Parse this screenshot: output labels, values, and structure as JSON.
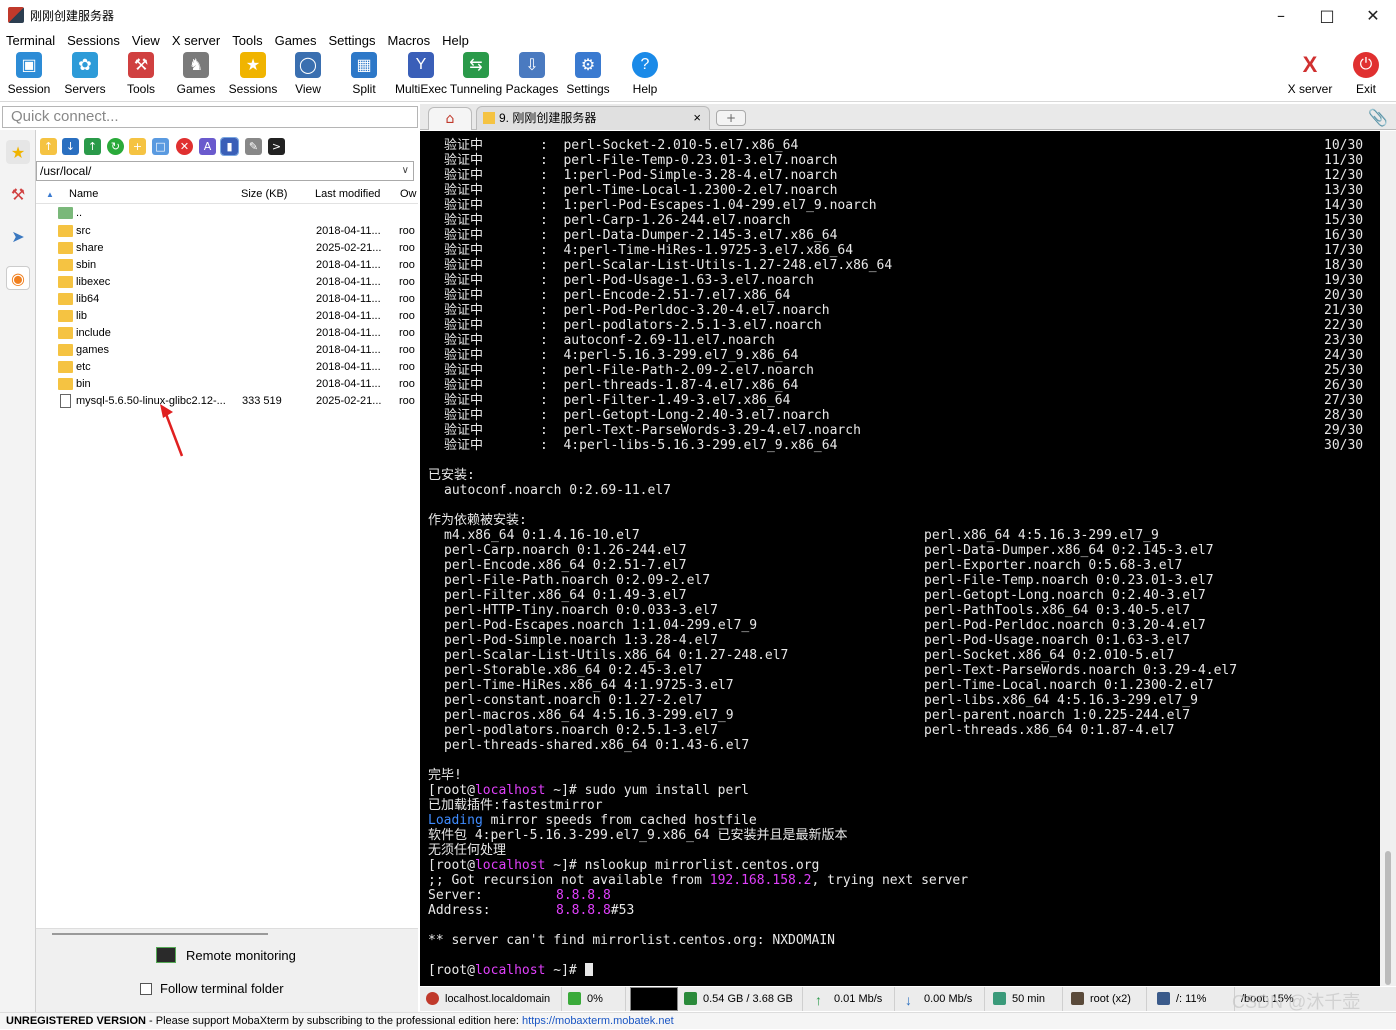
{
  "window": {
    "title": "刚刚创建服务器"
  },
  "menu": [
    "Terminal",
    "Sessions",
    "View",
    "X server",
    "Tools",
    "Games",
    "Settings",
    "Macros",
    "Help"
  ],
  "toolbar": {
    "left": [
      {
        "label": "Session",
        "icon": "monitor-icon",
        "color": "#2d8cd6"
      },
      {
        "label": "Servers",
        "icon": "servers-icon",
        "color": "#2d9bd8"
      },
      {
        "label": "Tools",
        "icon": "tools-icon",
        "color": "#d04040"
      },
      {
        "label": "Games",
        "icon": "games-icon",
        "color": "#7a7a7a"
      },
      {
        "label": "Sessions",
        "icon": "star-icon",
        "color": "#f0b400"
      },
      {
        "label": "View",
        "icon": "view-icon",
        "color": "#3a6fb0"
      },
      {
        "label": "Split",
        "icon": "split-icon",
        "color": "#2d78c8"
      },
      {
        "label": "MultiExec",
        "icon": "multiexec-icon",
        "color": "#3a5fb8"
      },
      {
        "label": "Tunneling",
        "icon": "tunneling-icon",
        "color": "#2a9a4a"
      },
      {
        "label": "Packages",
        "icon": "packages-icon",
        "color": "#4a7ac0"
      },
      {
        "label": "Settings",
        "icon": "gear-icon",
        "color": "#3a7ad0"
      },
      {
        "label": "Help",
        "icon": "help-icon",
        "color": "#1a8ae8"
      }
    ],
    "right": [
      {
        "label": "X server",
        "icon": "x-server-icon",
        "color": "#d03030"
      },
      {
        "label": "Exit",
        "icon": "power-icon",
        "color": "#e03030"
      }
    ]
  },
  "quick_connect": {
    "placeholder": "Quick connect..."
  },
  "file_browser": {
    "path": "/usr/local/",
    "columns": [
      "Name",
      "Size (KB)",
      "Last modified",
      "Ow"
    ],
    "rows": [
      {
        "name": "..",
        "size": "",
        "modified": "",
        "owner": "",
        "type": "up"
      },
      {
        "name": "src",
        "size": "",
        "modified": "2018-04-11...",
        "owner": "roo",
        "type": "folder"
      },
      {
        "name": "share",
        "size": "",
        "modified": "2025-02-21...",
        "owner": "roo",
        "type": "folder"
      },
      {
        "name": "sbin",
        "size": "",
        "modified": "2018-04-11...",
        "owner": "roo",
        "type": "folder"
      },
      {
        "name": "libexec",
        "size": "",
        "modified": "2018-04-11...",
        "owner": "roo",
        "type": "folder"
      },
      {
        "name": "lib64",
        "size": "",
        "modified": "2018-04-11...",
        "owner": "roo",
        "type": "folder"
      },
      {
        "name": "lib",
        "size": "",
        "modified": "2018-04-11...",
        "owner": "roo",
        "type": "folder"
      },
      {
        "name": "include",
        "size": "",
        "modified": "2018-04-11...",
        "owner": "roo",
        "type": "folder"
      },
      {
        "name": "games",
        "size": "",
        "modified": "2018-04-11...",
        "owner": "roo",
        "type": "folder"
      },
      {
        "name": "etc",
        "size": "",
        "modified": "2018-04-11...",
        "owner": "roo",
        "type": "folder"
      },
      {
        "name": "bin",
        "size": "",
        "modified": "2018-04-11...",
        "owner": "roo",
        "type": "folder"
      },
      {
        "name": "mysql-5.6.50-linux-glibc2.12-...",
        "size": "333 519",
        "modified": "2025-02-21...",
        "owner": "roo",
        "type": "file"
      }
    ],
    "remote_monitoring": "Remote monitoring",
    "follow_terminal_folder": "Follow terminal folder"
  },
  "tabs": {
    "active_label": "9. 刚刚创建服务器",
    "close": "×"
  },
  "terminal": {
    "verify_label": "验证中",
    "verify_rows": [
      {
        "pkg": "perl-Socket-2.010-5.el7.x86_64",
        "count": "10/30"
      },
      {
        "pkg": "perl-File-Temp-0.23.01-3.el7.noarch",
        "count": "11/30"
      },
      {
        "pkg": "1:perl-Pod-Simple-3.28-4.el7.noarch",
        "count": "12/30"
      },
      {
        "pkg": "perl-Time-Local-1.2300-2.el7.noarch",
        "count": "13/30"
      },
      {
        "pkg": "1:perl-Pod-Escapes-1.04-299.el7_9.noarch",
        "count": "14/30"
      },
      {
        "pkg": "perl-Carp-1.26-244.el7.noarch",
        "count": "15/30"
      },
      {
        "pkg": "perl-Data-Dumper-2.145-3.el7.x86_64",
        "count": "16/30"
      },
      {
        "pkg": "4:perl-Time-HiRes-1.9725-3.el7.x86_64",
        "count": "17/30"
      },
      {
        "pkg": "perl-Scalar-List-Utils-1.27-248.el7.x86_64",
        "count": "18/30"
      },
      {
        "pkg": "perl-Pod-Usage-1.63-3.el7.noarch",
        "count": "19/30"
      },
      {
        "pkg": "perl-Encode-2.51-7.el7.x86_64",
        "count": "20/30"
      },
      {
        "pkg": "perl-Pod-Perldoc-3.20-4.el7.noarch",
        "count": "21/30"
      },
      {
        "pkg": "perl-podlators-2.5.1-3.el7.noarch",
        "count": "22/30"
      },
      {
        "pkg": "autoconf-2.69-11.el7.noarch",
        "count": "23/30"
      },
      {
        "pkg": "4:perl-5.16.3-299.el7_9.x86_64",
        "count": "24/30"
      },
      {
        "pkg": "perl-File-Path-2.09-2.el7.noarch",
        "count": "25/30"
      },
      {
        "pkg": "perl-threads-1.87-4.el7.x86_64",
        "count": "26/30"
      },
      {
        "pkg": "perl-Filter-1.49-3.el7.x86_64",
        "count": "27/30"
      },
      {
        "pkg": "perl-Getopt-Long-2.40-3.el7.noarch",
        "count": "28/30"
      },
      {
        "pkg": "perl-Text-ParseWords-3.29-4.el7.noarch",
        "count": "29/30"
      },
      {
        "pkg": "4:perl-libs-5.16.3-299.el7_9.x86_64",
        "count": "30/30"
      }
    ],
    "installed_header": "已安装:",
    "installed_item": "autoconf.noarch 0:2.69-11.el7",
    "deps_header": "作为依赖被安装:",
    "deps_left": [
      "m4.x86_64 0:1.4.16-10.el7",
      "perl-Carp.noarch 0:1.26-244.el7",
      "perl-Encode.x86_64 0:2.51-7.el7",
      "perl-File-Path.noarch 0:2.09-2.el7",
      "perl-Filter.x86_64 0:1.49-3.el7",
      "perl-HTTP-Tiny.noarch 0:0.033-3.el7",
      "perl-Pod-Escapes.noarch 1:1.04-299.el7_9",
      "perl-Pod-Simple.noarch 1:3.28-4.el7",
      "perl-Scalar-List-Utils.x86_64 0:1.27-248.el7",
      "perl-Storable.x86_64 0:2.45-3.el7",
      "perl-Time-HiRes.x86_64 4:1.9725-3.el7",
      "perl-constant.noarch 0:1.27-2.el7",
      "perl-macros.x86_64 4:5.16.3-299.el7_9",
      "perl-podlators.noarch 0:2.5.1-3.el7",
      "perl-threads-shared.x86_64 0:1.43-6.el7"
    ],
    "deps_right": [
      "perl.x86_64 4:5.16.3-299.el7_9",
      "perl-Data-Dumper.x86_64 0:2.145-3.el7",
      "perl-Exporter.noarch 0:5.68-3.el7",
      "perl-File-Temp.noarch 0:0.23.01-3.el7",
      "perl-Getopt-Long.noarch 0:2.40-3.el7",
      "perl-PathTools.x86_64 0:3.40-5.el7",
      "perl-Pod-Perldoc.noarch 0:3.20-4.el7",
      "perl-Pod-Usage.noarch 0:1.63-3.el7",
      "perl-Socket.x86_64 0:2.010-5.el7",
      "perl-Text-ParseWords.noarch 0:3.29-4.el7",
      "perl-Time-Local.noarch 0:1.2300-2.el7",
      "perl-libs.x86_64 4:5.16.3-299.el7_9",
      "perl-parent.noarch 1:0.225-244.el7",
      "perl-threads.x86_64 0:1.87-4.el7"
    ],
    "done": "完毕!",
    "prompt_user": "root",
    "prompt_at": "@",
    "prompt_host": "localhost",
    "prompt_dir": " ~]# ",
    "cmd1": "sudo yum install perl",
    "plugins_loaded": "已加载插件:fastestmirror",
    "loading_word": "Loading",
    "loading_rest": " mirror speeds from cached hostfile",
    "pkg_latest": "软件包 4:perl-5.16.3-299.el7_9.x86_64 已安装并且是最新版本",
    "nothing_to_do": "无须任何处理",
    "cmd2": "nslookup mirrorlist.centos.org",
    "recursion_pre": ";; Got recursion not available from ",
    "recursion_ip": "192.168.158.2",
    "recursion_post": ", trying next server",
    "server_label": "Server:",
    "server_val": "8.8.8.8",
    "address_label": "Address:",
    "address_val": "8.8.8.8",
    "address_port": "#53",
    "nxdomain": "** server can't find mirrorlist.centos.org: NXDOMAIN"
  },
  "status": {
    "host": "localhost.localdomain",
    "cpu": "0%",
    "mem": "0.54 GB / 3.68 GB",
    "up": "0.01 Mb/s",
    "down": "0.00 Mb/s",
    "uptime": "50 min",
    "user": "root (x2)",
    "disk1": "/: 11%",
    "disk2": "/boot: 15%"
  },
  "footer": {
    "unreg": "UNREGISTERED VERSION",
    "msg": "  -  Please support MobaXterm by subscribing to the professional edition here: ",
    "link": "https://mobaxterm.mobatek.net"
  },
  "watermark": "CSDN @沐千壶"
}
